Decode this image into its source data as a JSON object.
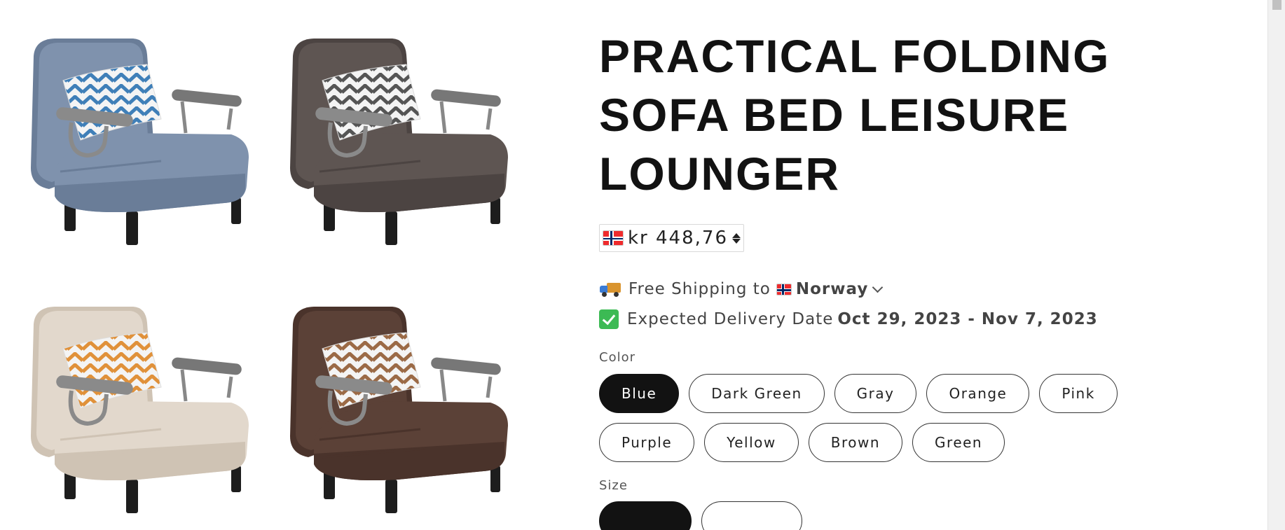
{
  "product": {
    "title": "PRACTICAL FOLDING SOFA BED LEISURE LOUNGER",
    "price": "kr 448,76",
    "currency_flag_icon": "norway-flag-icon"
  },
  "shipping": {
    "prefix": "Free Shipping to",
    "country": "Norway",
    "delivery_label": "Expected Delivery Date",
    "delivery_range": "Oct 29, 2023 - Nov 7, 2023"
  },
  "options": {
    "color_label": "Color",
    "colors": [
      "Blue",
      "Dark Green",
      "Gray",
      "Orange",
      "Pink",
      "Purple",
      "Yellow",
      "Brown",
      "Green"
    ],
    "selected_color": "Blue",
    "size_label": "Size"
  },
  "gallery": {
    "images": [
      {
        "name": "blue-chair-image",
        "fabric": "#7f92ad",
        "fabric_dark": "#6a7d98",
        "pillow": "#3f7fb8"
      },
      {
        "name": "gray-chair-image",
        "fabric": "#5e5552",
        "fabric_dark": "#4c4442",
        "pillow": "#555"
      },
      {
        "name": "beige-chair-image",
        "fabric": "#e2d8cc",
        "fabric_dark": "#cfc3b4",
        "pillow": "#e0913a"
      },
      {
        "name": "brown-chair-image",
        "fabric": "#5b4137",
        "fabric_dark": "#4a332b",
        "pillow": "#9b6a46"
      }
    ]
  }
}
